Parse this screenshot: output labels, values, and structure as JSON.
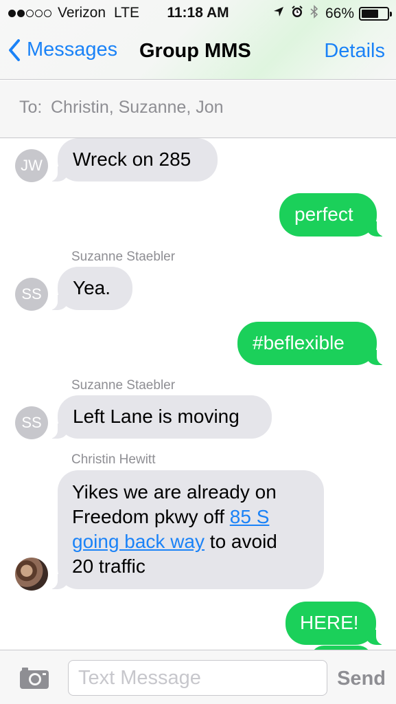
{
  "status_bar": {
    "carrier": "Verizon",
    "network": "LTE",
    "time": "11:18 AM",
    "battery_percent_label": "66%",
    "battery_level": 0.66,
    "signal_bars_filled": 2,
    "signal_bars_total": 5,
    "icons": [
      "location-arrow-icon",
      "alarm-icon",
      "bluetooth-icon",
      "battery-icon"
    ]
  },
  "nav": {
    "back_label": "Messages",
    "title": "Group MMS",
    "details_label": "Details"
  },
  "recipients": {
    "to_label": "To:",
    "names": "Christin, Suzanne, Jon"
  },
  "messages": [
    {
      "direction": "incoming",
      "initials": "JW",
      "text": "Wreck on 285"
    },
    {
      "direction": "outgoing",
      "text": "perfect"
    },
    {
      "direction": "incoming",
      "sender": "Suzanne Staebler",
      "initials": "SS",
      "text": "Yea."
    },
    {
      "direction": "outgoing",
      "text": "#beflexible"
    },
    {
      "direction": "incoming",
      "sender": "Suzanne Staebler",
      "initials": "SS",
      "text": "Left Lane is moving"
    },
    {
      "direction": "incoming",
      "sender": "Christin Hewitt",
      "avatar": "photo",
      "line1": "Yikes we are already on",
      "line2_pre": "Freedom pkwy off ",
      "link1": "85 S",
      "link2": "going back way",
      "line3_post": " to avoid",
      "line4": "20 traffic"
    },
    {
      "direction": "outgoing",
      "text": "HERE!"
    }
  ],
  "input_bar": {
    "placeholder": "Text Message",
    "send_label": "Send"
  },
  "colors": {
    "ios_blue": "#1a82f7",
    "outgoing_bubble": "#1bd05a",
    "incoming_bubble": "#e5e5ea",
    "avatar_gray": "#c7c7cc",
    "secondary_text": "#8e8e93"
  }
}
